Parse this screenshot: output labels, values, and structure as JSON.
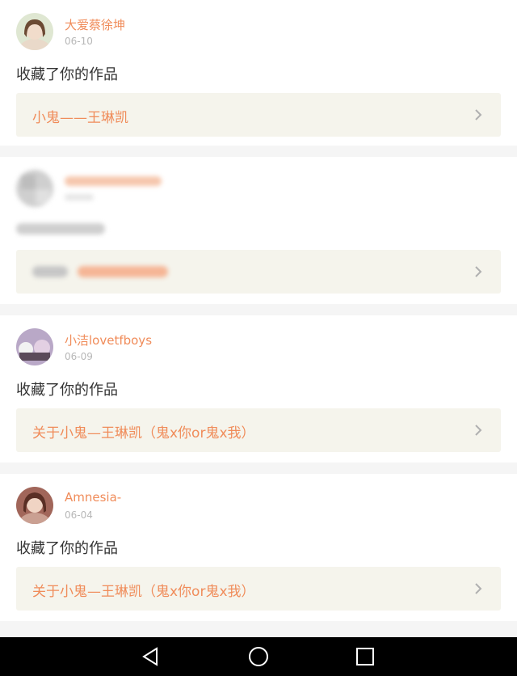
{
  "feed": [
    {
      "username": "大爱蔡徐坤",
      "date": "06-10",
      "action": "收藏了你的作品",
      "work_title": "小鬼——王琳凯",
      "avatar_icon": "user-avatar-icon"
    },
    {
      "username": "",
      "date": "",
      "action": "",
      "work_title": "",
      "avatar_icon": "blurred-avatar-icon",
      "blurred": true
    },
    {
      "username": "小洁lovetfboys",
      "date": "06-09",
      "action": "收藏了你的作品",
      "work_title": "关于小鬼—王琳凯（鬼x你or鬼x我）",
      "avatar_icon": "user-avatar-icon"
    },
    {
      "username": "Amnesia-",
      "date": "06-04",
      "action": "收藏了你的作品",
      "work_title": "关于小鬼—王琳凯（鬼x你or鬼x我）",
      "avatar_icon": "user-avatar-icon"
    }
  ],
  "colors": {
    "accent": "#f08c5a",
    "work_bg": "#f5f4ec",
    "text": "#333333",
    "meta": "#b8b8b8"
  },
  "navbar": {
    "back": "back-triangle-icon",
    "home": "home-circle-icon",
    "recents": "recents-square-icon"
  }
}
